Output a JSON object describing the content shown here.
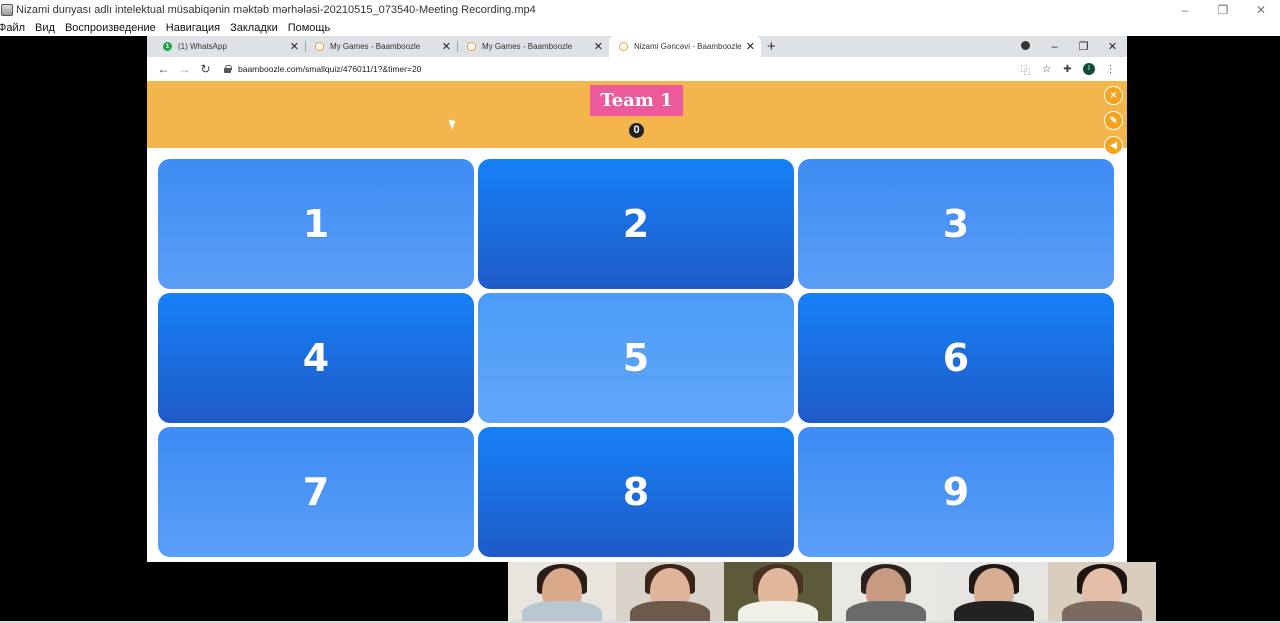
{
  "player": {
    "title": "Nizami dunyası adlı intelektual müsabiqənin məktəb mərhələsi-20210515_073540-Meeting Recording.mp4",
    "menu": [
      "Файл",
      "Вид",
      "Воспроизведение",
      "Навигация",
      "Закладки",
      "Помощь"
    ]
  },
  "browser": {
    "tabs": [
      {
        "label": "(1) WhatsApp",
        "favicon": "whatsapp-icon",
        "active": false
      },
      {
        "label": "My Games - Baamboozle",
        "favicon": "baamboozle-icon",
        "active": false
      },
      {
        "label": "My Games - Baamboozle",
        "favicon": "baamboozle-icon",
        "active": false
      },
      {
        "label": "Nizami Gəncəvi - Baamboozle",
        "favicon": "baamboozle-icon",
        "active": true
      }
    ],
    "url": "baamboozle.com/smallquiz/476011/1?&timer=20",
    "account_initial": "I"
  },
  "game": {
    "team_name": "Team 1",
    "team_score": "0",
    "tiles": [
      {
        "label": "1",
        "style": "light"
      },
      {
        "label": "2",
        "style": "dark"
      },
      {
        "label": "3",
        "style": "light"
      },
      {
        "label": "4",
        "style": "dark"
      },
      {
        "label": "5",
        "style": "lightest"
      },
      {
        "label": "6",
        "style": "dark"
      },
      {
        "label": "7",
        "style": "light"
      },
      {
        "label": "8",
        "style": "dark"
      },
      {
        "label": "9",
        "style": "light"
      }
    ],
    "colors": {
      "team_bar": "#f4b54d",
      "team_badge": "#ec5a9b",
      "tool_button": "#f7a21b"
    }
  },
  "participants": [
    {
      "bg": "#e9e4dd",
      "skin": "#d9a98a",
      "hair": "#2a1d18",
      "clothes": "#b8c7d1"
    },
    {
      "bg": "#d8d2c8",
      "skin": "#e0b49a",
      "hair": "#3a2418",
      "clothes": "#6c5a4a"
    },
    {
      "bg": "#5d5a3c",
      "skin": "#e2b89c",
      "hair": "#4a3020",
      "clothes": "#f2efe9"
    },
    {
      "bg": "#e9e7e2",
      "skin": "#c89a82",
      "hair": "#2b211c",
      "clothes": "#6a6a6a"
    },
    {
      "bg": "#e7e5e1",
      "skin": "#d7ad93",
      "hair": "#1e1715",
      "clothes": "#222222"
    },
    {
      "bg": "#d9cdbd",
      "skin": "#e4bea6",
      "hair": "#1d1411",
      "clothes": "#7a6a60"
    }
  ]
}
